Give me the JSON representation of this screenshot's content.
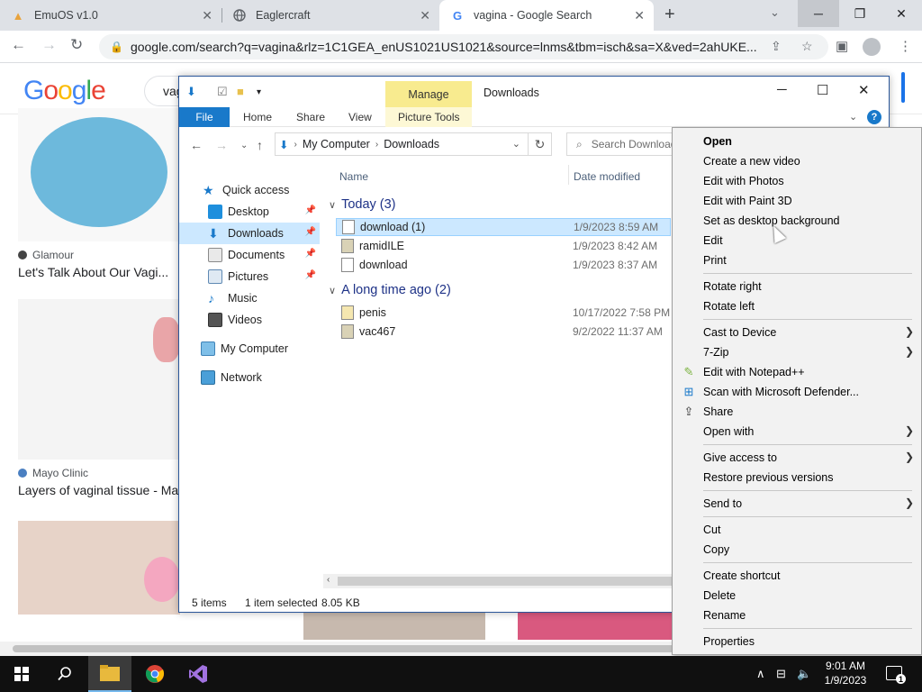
{
  "browser": {
    "tabs": [
      {
        "title": "EmuOS v1.0",
        "icon": "emuos-icon"
      },
      {
        "title": "Eaglercraft",
        "icon": "globe-icon"
      },
      {
        "title": "vagina - Google Search",
        "icon": "google-icon"
      }
    ],
    "url": "google.com/search?q=vagina&rlz=1C1GEA_enUS1021US1021&source=lnms&tbm=isch&sa=X&ved=2ahUKE..."
  },
  "google": {
    "logo": "Google",
    "query": "vag",
    "results": [
      {
        "source": "Glamour",
        "title": "Let's Talk About Our Vagi..."
      },
      {
        "source": "Mayo Clinic",
        "title": "Layers of vaginal tissue - Ma"
      }
    ]
  },
  "explorer": {
    "title": "Downloads",
    "manage": "Manage",
    "ribbon_tabs": [
      "File",
      "Home",
      "Share",
      "View",
      "Picture Tools"
    ],
    "breadcrumb": [
      "My Computer",
      "Downloads"
    ],
    "search_placeholder": "Search Downloads",
    "nav": [
      {
        "label": "Quick access",
        "icon": "star-icon"
      },
      {
        "label": "Desktop",
        "icon": "desktop-icon",
        "pinned": true
      },
      {
        "label": "Downloads",
        "icon": "download-arrow-icon",
        "pinned": true,
        "selected": true
      },
      {
        "label": "Documents",
        "icon": "documents-icon",
        "pinned": true
      },
      {
        "label": "Pictures",
        "icon": "pictures-icon",
        "pinned": true
      },
      {
        "label": "Music",
        "icon": "music-icon"
      },
      {
        "label": "Videos",
        "icon": "videos-icon"
      },
      {
        "label": "My Computer",
        "icon": "computer-icon"
      },
      {
        "label": "Network",
        "icon": "network-icon"
      }
    ],
    "columns": {
      "name": "Name",
      "date": "Date modified"
    },
    "groups": [
      {
        "label": "Today (3)",
        "files": [
          {
            "name": "download (1)",
            "date": "1/9/2023 8:59 AM",
            "selected": true
          },
          {
            "name": "ramidILE",
            "date": "1/9/2023 8:42 AM"
          },
          {
            "name": "download",
            "date": "1/9/2023 8:37 AM"
          }
        ]
      },
      {
        "label": "A long time ago (2)",
        "files": [
          {
            "name": "penis",
            "date": "10/17/2022 7:58 PM"
          },
          {
            "name": "vac467",
            "date": "9/2/2022 11:37 AM"
          }
        ]
      }
    ],
    "status": {
      "items": "5 items",
      "selected": "1 item selected",
      "size": "8.05 KB"
    }
  },
  "context_menu": {
    "items": [
      "Open",
      "Create a new video",
      "Edit with Photos",
      "Edit with Paint 3D",
      "Set as desktop background",
      "Edit",
      "Print",
      "Rotate right",
      "Rotate left",
      "Cast to Device",
      "7-Zip",
      "Edit with Notepad++",
      "Scan with Microsoft Defender...",
      "Share",
      "Open with",
      "Give access to",
      "Restore previous versions",
      "Send to",
      "Cut",
      "Copy",
      "Create shortcut",
      "Delete",
      "Rename",
      "Properties"
    ]
  },
  "taskbar": {
    "time": "9:01 AM",
    "date": "1/9/2023",
    "notifications": "1"
  },
  "colors": {
    "accent": "#1979ca",
    "selection": "#cce8ff",
    "manage": "#f8eb8f"
  }
}
